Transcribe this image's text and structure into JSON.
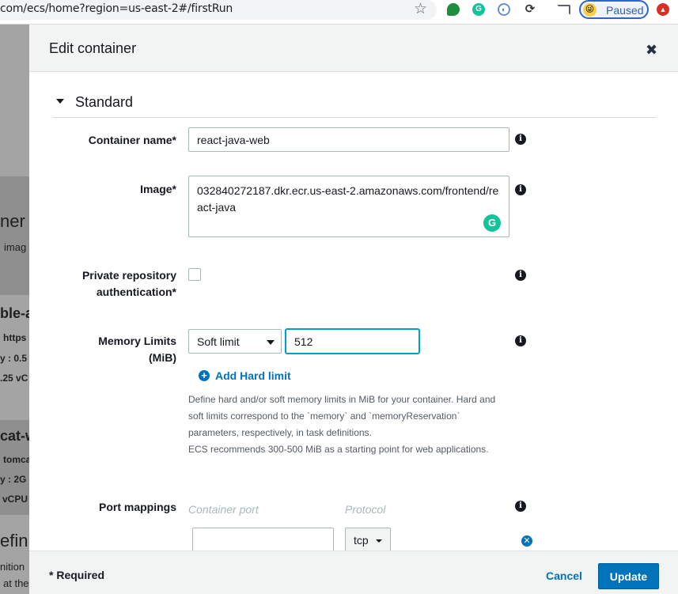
{
  "browser": {
    "url": "com/ecs/home?region=us-east-2#/firstRun",
    "profile_status": "Paused",
    "icons": [
      "star-icon",
      "green-speech-extension-icon",
      "grammarly-extension-icon",
      "blue-extension-icon",
      "sync-extension-icon",
      "cast-icon",
      "profile-avatar-icon",
      "red-extension-icon"
    ]
  },
  "background_page": {
    "fragments": [
      "ner",
      "imag",
      "ble-a",
      "https",
      "y : 0.5",
      ".25 vC",
      "cat-w",
      "tomca",
      "y : 2G",
      "vCPU",
      "efini",
      "nition",
      "at the"
    ]
  },
  "modal": {
    "title": "Edit container",
    "section_title": "Standard",
    "fields": {
      "container_name": {
        "label": "Container name*",
        "value": "react-java-web"
      },
      "image": {
        "label": "Image*",
        "value": "032840272187.dkr.ecr.us-east-2.amazonaws.com/frontend/react-java"
      },
      "private_repo": {
        "label_line1": "Private repository",
        "label_line2": "authentication*",
        "checked": false
      },
      "memory": {
        "label_line1": "Memory Limits",
        "label_line2": "(MiB)",
        "limit_type": "Soft limit",
        "value": "512",
        "add_hard_label": "Add Hard limit",
        "help": [
          "Define hard and/or soft memory limits in MiB for your container. Hard and",
          "soft limits correspond to the `memory` and `memoryReservation`",
          "parameters, respectively, in task definitions.",
          "ECS recommends 300-500 MiB as a starting point for web applications."
        ]
      },
      "port_mappings": {
        "label": "Port mappings",
        "col_container_port": "Container port",
        "col_protocol": "Protocol",
        "container_port_value": "",
        "protocol_value": "tcp"
      }
    },
    "footer": {
      "required_note": "* Required",
      "cancel_label": "Cancel",
      "update_label": "Update"
    }
  },
  "colors": {
    "primary_blue": "#0073bb",
    "focus_ring": "#00a1c9",
    "header_bg": "#f2f3f3",
    "text_dark": "#16191f",
    "help_text": "#545b64"
  }
}
